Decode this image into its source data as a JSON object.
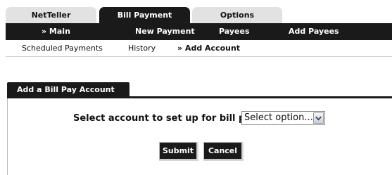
{
  "tabs": [
    {
      "label": "NetTeller"
    },
    {
      "label": "Bill Payment"
    },
    {
      "label": "Options"
    }
  ],
  "nav": {
    "items": [
      {
        "label": "» Main"
      },
      {
        "label": "New Payment"
      },
      {
        "label": "Payees"
      },
      {
        "label": "Add Payees"
      }
    ]
  },
  "subnav": {
    "items": [
      {
        "label": "Scheduled Payments"
      },
      {
        "label": "History"
      },
      {
        "label": "» Add Account"
      }
    ]
  },
  "panel": {
    "tab_label": "Add a Bill Pay Account",
    "select_label": "Select account to set up for bill pay:",
    "select_value": "Select option...",
    "submit_label": "Submit",
    "cancel_label": "Cancel"
  },
  "icons": {
    "select_arrow": "chevron-down-icon"
  },
  "colors": {
    "nav_dark": "#1a1a1a",
    "tab_inactive": "#e2e2e2",
    "text": "#111111"
  }
}
